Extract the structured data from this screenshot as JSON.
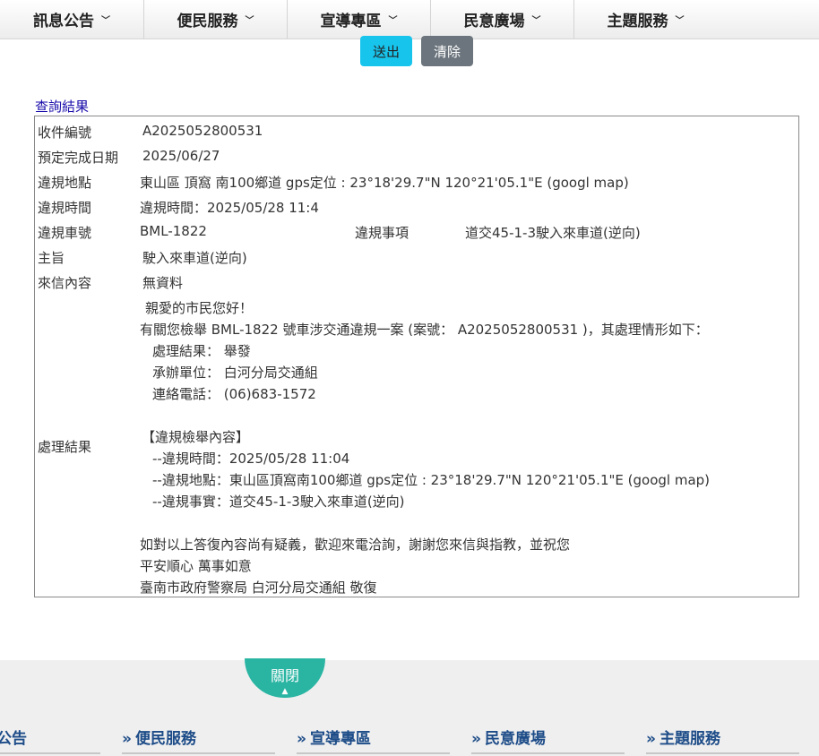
{
  "topnav": [
    "訊息公告",
    "便民服務",
    "宣導專區",
    "民意廣場",
    "主題服務"
  ],
  "buttons": {
    "submit": "送出",
    "clear": "清除"
  },
  "result": {
    "title": "查詢結果",
    "case_no_label": "收件編號",
    "case_no": "A2025052800531",
    "due_label": "預定完成日期",
    "due": "2025/06/27",
    "place_label": "違規地點",
    "place": "東山區 頂窩 南100鄉道 gps定位 : 23°18'29.7\"N 120°21'05.1\"E (googl map)",
    "time_label": "違規時間",
    "time": "違規時間：2025/05/28 11:4",
    "plate_label": "違規車號",
    "plate": "BML-1822",
    "item_label": "違規事項",
    "item": "道交45-1-3駛入來車道(逆向)",
    "subject_label": "主旨",
    "subject": "駛入來車道(逆向)",
    "letter_label": "來信內容",
    "letter": "無資料",
    "process_label": "處理結果",
    "process_lines": [
      "親愛的市民您好！",
      "有關您檢舉 BML-1822 號車涉交通違規一案 (案號： A2025052800531 )，其處理情形如下：",
      "處理結果： 舉發",
      "承辦單位： 白河分局交通組",
      "連絡電話： (06)683-1572",
      "【違規檢舉內容】",
      "--違規時間：2025/05/28 11:04",
      "--違規地點：東山區頂窩南100鄉道 gps定位 : 23°18'29.7\"N 120°21'05.1\"E (googl map)",
      "--違規事實：道交45-1-3駛入來車道(逆向)",
      "如對以上答復內容尚有疑義，歡迎來電洽詢，謝謝您來信與指教，並祝您",
      "平安順心 萬事如意",
      "臺南市政府警察局 白河分局交通組 敬復"
    ]
  },
  "footer": {
    "close_label": "關閉",
    "nav": [
      "公告",
      "便民服務",
      "宣導專區",
      "民意廣場",
      "主題服務"
    ],
    "marker": "»"
  }
}
